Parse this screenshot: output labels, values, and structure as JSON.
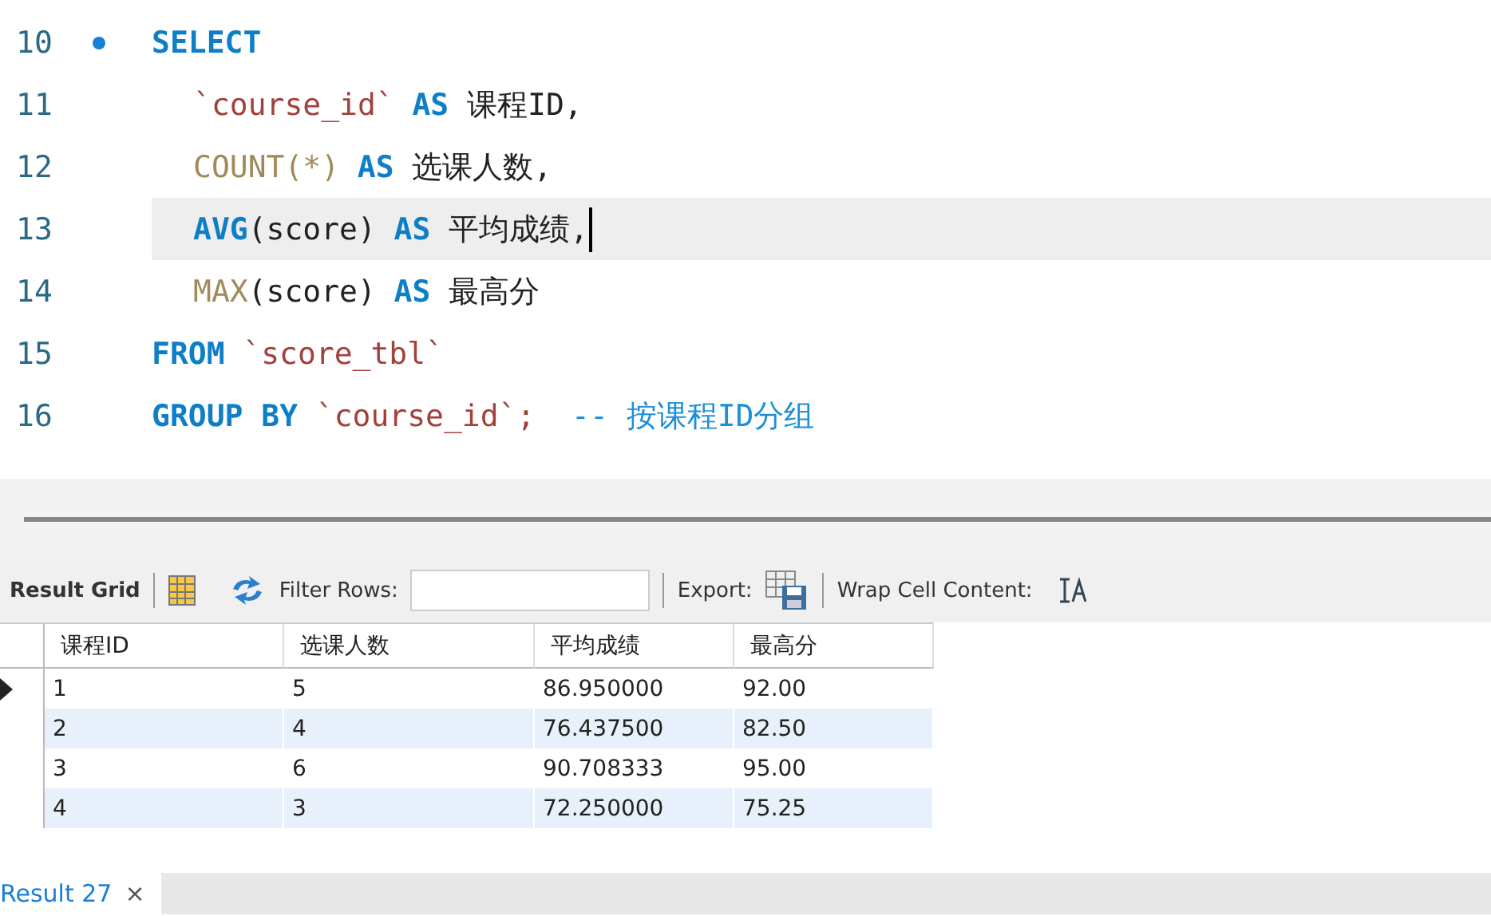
{
  "editor": {
    "lines": [
      {
        "number": "10",
        "marker": true,
        "indented": false,
        "current": false,
        "tokens": [
          {
            "kind": "keyword",
            "text": "SELECT"
          }
        ]
      },
      {
        "number": "11",
        "marker": false,
        "indented": true,
        "current": false,
        "tokens": [
          {
            "kind": "identifier",
            "text": "`course_id`"
          },
          {
            "kind": "keyword",
            "text": "AS"
          },
          {
            "kind": "plain",
            "text": "课程ID,"
          }
        ]
      },
      {
        "number": "12",
        "marker": false,
        "indented": true,
        "current": false,
        "tokens": [
          {
            "kind": "function",
            "text": "COUNT(*)"
          },
          {
            "kind": "keyword",
            "text": "AS"
          },
          {
            "kind": "plain",
            "text": "选课人数,"
          }
        ]
      },
      {
        "number": "13",
        "marker": false,
        "indented": true,
        "current": true,
        "tokens": [
          {
            "kind": "function_bold",
            "text": "AVG"
          },
          {
            "kind": "plain_tight",
            "text": "(score)"
          },
          {
            "kind": "keyword",
            "text": "AS"
          },
          {
            "kind": "plain",
            "text": "平均成绩,"
          }
        ]
      },
      {
        "number": "14",
        "marker": false,
        "indented": true,
        "current": false,
        "tokens": [
          {
            "kind": "function",
            "text": "MAX"
          },
          {
            "kind": "plain_tight",
            "text": "(score)"
          },
          {
            "kind": "keyword",
            "text": "AS"
          },
          {
            "kind": "plain",
            "text": "最高分"
          }
        ]
      },
      {
        "number": "15",
        "marker": false,
        "indented": false,
        "current": false,
        "tokens": [
          {
            "kind": "keyword",
            "text": "FROM"
          },
          {
            "kind": "identifier",
            "text": "`score_tbl`"
          }
        ]
      },
      {
        "number": "16",
        "marker": false,
        "indented": false,
        "current": false,
        "tokens": [
          {
            "kind": "keyword",
            "text": "GROUP BY"
          },
          {
            "kind": "identifier",
            "text": "`course_id`;"
          },
          {
            "kind": "comment",
            "text": " -- 按课程ID分组"
          }
        ]
      }
    ]
  },
  "toolbar": {
    "result_grid": "Result Grid",
    "filter_label": "Filter Rows:",
    "export_label": "Export:",
    "wrap_label": "Wrap Cell Content:"
  },
  "table": {
    "columns": [
      "课程ID",
      "选课人数",
      "平均成绩",
      "最高分"
    ],
    "rows": [
      {
        "selected": true,
        "cells": [
          "1",
          "5",
          "86.950000",
          "92.00"
        ]
      },
      {
        "selected": false,
        "cells": [
          "2",
          "4",
          "76.437500",
          "82.50"
        ]
      },
      {
        "selected": false,
        "cells": [
          "3",
          "6",
          "90.708333",
          "95.00"
        ]
      },
      {
        "selected": false,
        "cells": [
          "4",
          "3",
          "72.250000",
          "75.25"
        ]
      }
    ]
  },
  "result_tabs": [
    {
      "label": "Result 27",
      "close": "×"
    }
  ]
}
